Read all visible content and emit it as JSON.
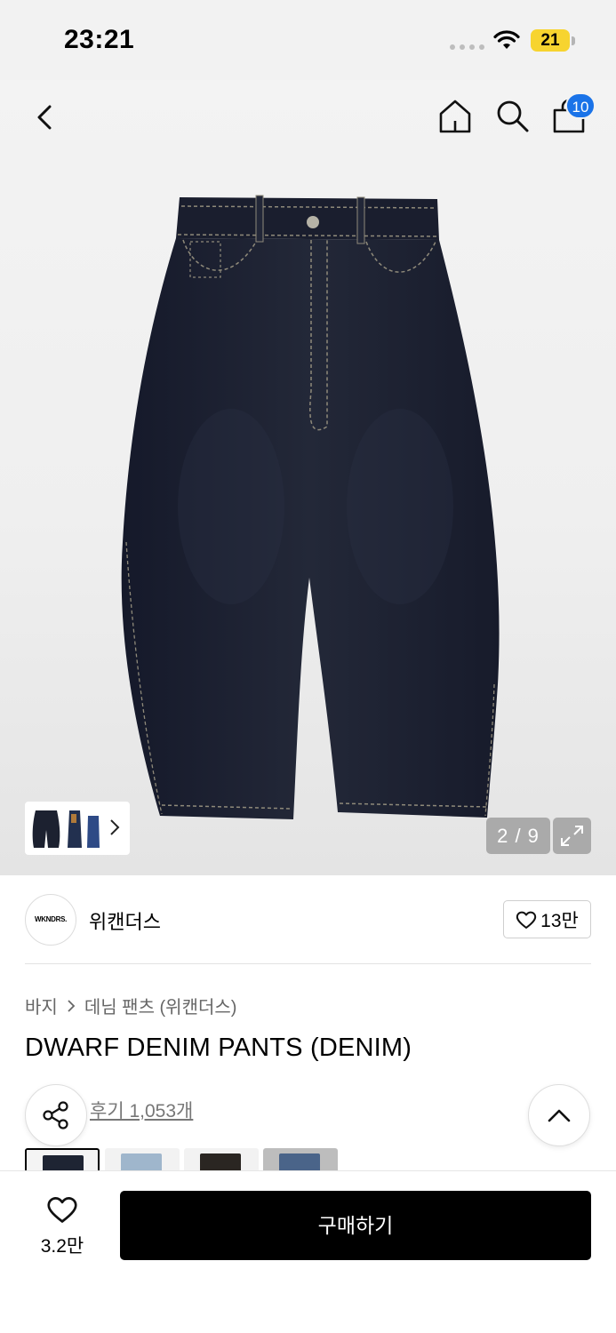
{
  "status_bar": {
    "time": "23:21",
    "battery": "21"
  },
  "header": {
    "cart_count": "10"
  },
  "gallery": {
    "counter": "2 / 9"
  },
  "brand": {
    "logo_text": "WKNDRS.",
    "name": "위캔더스",
    "likes": "13만"
  },
  "breadcrumb": {
    "category": "바지",
    "subcategory": "데님 팬츠 (위캔더스)"
  },
  "product": {
    "title": "DWARF DENIM PANTS (DENIM)",
    "reviews": "후기 1,053개"
  },
  "swatches": [
    {
      "name": "dark-denim",
      "color": "#1e2433",
      "selected": true
    },
    {
      "name": "light-wash",
      "color": "#9fb6cc",
      "selected": false
    },
    {
      "name": "black-denim",
      "color": "#2a2622",
      "selected": false
    },
    {
      "name": "mid-blue",
      "color": "#4a6489",
      "selected": false
    }
  ],
  "bottom_bar": {
    "wish_count": "3.2만",
    "buy_label": "구매하기"
  },
  "colors": {
    "accent": "#1a73e8",
    "battery": "#f7d42f",
    "denim": "#1c2130"
  }
}
